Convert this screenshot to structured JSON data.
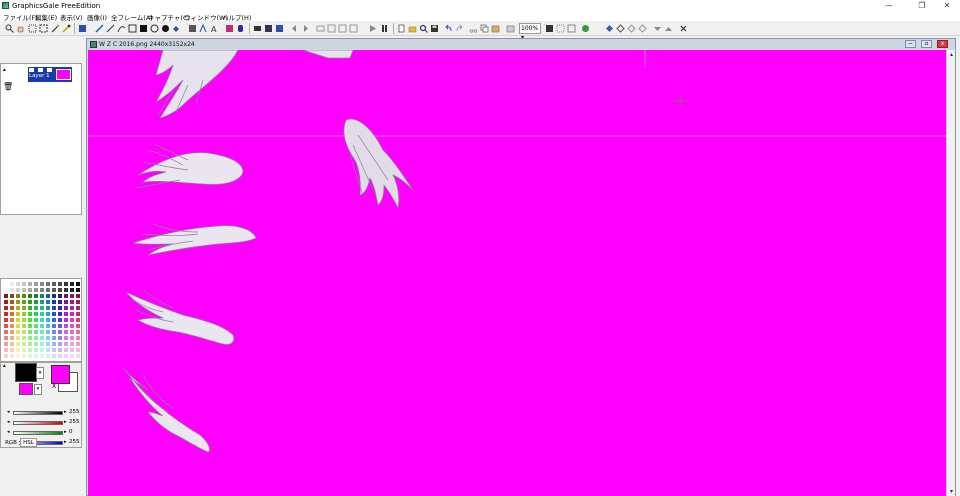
{
  "app": {
    "title": "GraphicsGale FreeEdition"
  },
  "window_controls": {
    "minimize": "—",
    "restore": "❐",
    "close": "✕"
  },
  "menu": [
    {
      "label": "ファイル(F)"
    },
    {
      "label": "編集(E)"
    },
    {
      "label": "表示(V)"
    },
    {
      "label": "画像(I)"
    },
    {
      "label": "全フレーム(A)"
    },
    {
      "label": "キャプチャ(C)"
    },
    {
      "label": "ウィンドウ(W)"
    },
    {
      "label": "ヘルプ(H)"
    }
  ],
  "toolbar": {
    "zoom": "100%"
  },
  "document": {
    "title": "W Z C 2016.png 2440x3152x24",
    "controls": {
      "minimize": "−",
      "restore": "▫",
      "close": "x"
    },
    "background": "#ff00ff"
  },
  "layers": {
    "items": [
      {
        "name": "Layer 1"
      }
    ]
  },
  "colors": {
    "primary": "#000000",
    "secondary": "#ff00ff",
    "swap_label": "X",
    "sliders": [
      {
        "color": "#000000",
        "value": "255"
      },
      {
        "color": "#cc0000",
        "value": "255"
      },
      {
        "color": "#008800",
        "value": "0"
      },
      {
        "color": "#0000cc",
        "value": "255"
      }
    ],
    "tabs": [
      "RGB",
      "HSL"
    ]
  }
}
